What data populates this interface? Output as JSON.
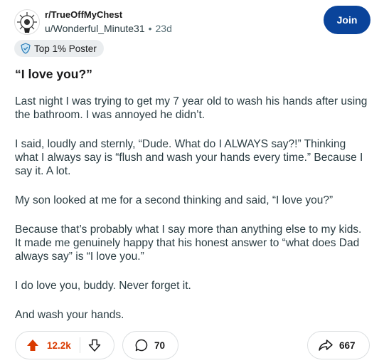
{
  "post": {
    "subreddit": "r/TrueOffMyChest",
    "author": "u/Wonderful_Minute31",
    "separator": "•",
    "age": "23d",
    "join_label": "Join",
    "flair": "Top 1% Poster",
    "title": "“I love you?”",
    "paragraphs": [
      "Last night I was trying to get my 7 year old to wash his hands after using the bathroom. I was annoyed he didn’t.",
      "I said, loudly and sternly, “Dude. What do I ALWAYS say?!” Thinking what I always say is “flush and wash your hands every time.” Because I say it. A lot.",
      "My son looked at me for a second thinking and said, “I love you?”",
      "Because that’s probably what I say more than anything else to my kids. It made me genuinely happy that his honest answer to “what does Dad always say” is “I love you.”",
      "I do love you, buddy. Never forget it.",
      "And wash your hands."
    ]
  },
  "actions": {
    "score": "12.2k",
    "comments": "70",
    "shares": "667"
  },
  "colors": {
    "join_bg": "#0a449b",
    "upvote": "#d93a00",
    "flair_bg": "#eaedef"
  },
  "icons": [
    "subreddit-avatar-icon",
    "shield-badge-icon",
    "upvote-arrow-icon",
    "downvote-arrow-icon",
    "comment-bubble-icon",
    "share-arrow-icon"
  ]
}
